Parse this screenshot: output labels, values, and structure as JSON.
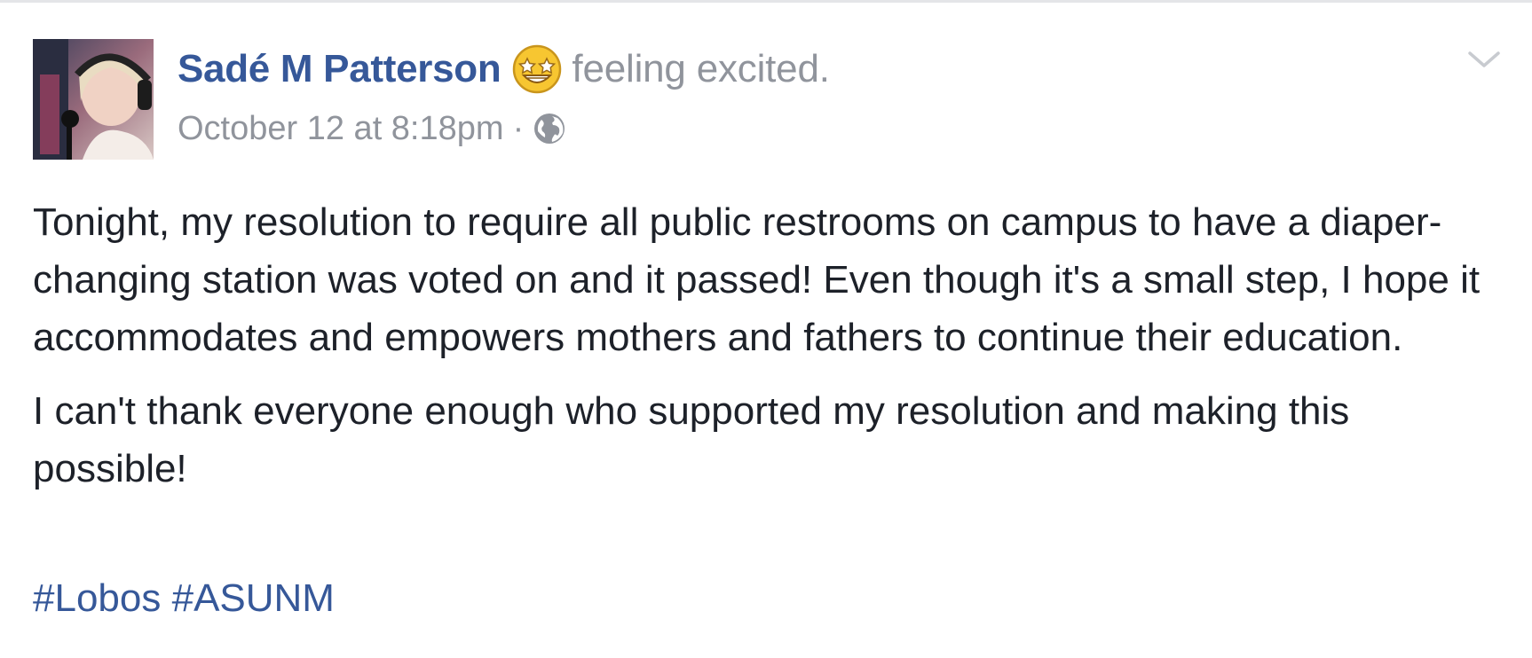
{
  "post": {
    "author_name": "Sadé M Patterson",
    "feeling_text": "feeling excited.",
    "feeling_icon": "star-struck-emoji-icon",
    "timestamp": "October 12 at 8:18pm",
    "separator": "·",
    "privacy_icon": "globe-icon",
    "options_icon": "chevron-down-icon",
    "paragraphs": [
      "Tonight, my resolution to require all public restrooms on campus to have a diaper-changing station was voted on and it passed! Even though it's a small step, I hope it accommodates and empowers mothers and fathers to continue their education.",
      "I can't thank everyone enough who supported my resolution and making this possible!"
    ],
    "hashtags": [
      "#Lobos",
      "#ASUNM"
    ]
  },
  "colors": {
    "link_blue": "#365899",
    "meta_gray": "#90949c",
    "body_text": "#1d2129",
    "divider": "#e4e5e8"
  }
}
